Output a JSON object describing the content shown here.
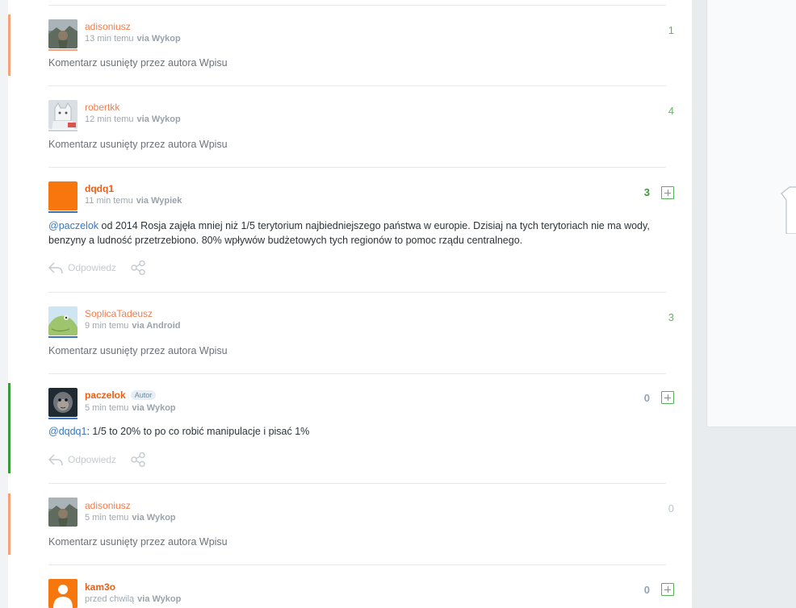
{
  "colors": {
    "username_orange": "#f07c4c",
    "username_strong": "#ee5d14",
    "score_green": "#5cb85c",
    "score_muted": "#8fa5b8",
    "mention_blue": "#3b77b7",
    "marker_orange": "#f4a27a",
    "marker_green": "#3a9a3a"
  },
  "comments": [
    {
      "username": "adisoniusz",
      "time": "13 min temu",
      "via": "via Wykop",
      "score": "1",
      "deleted_text": "Komentarz usunięty przez autora Wpisu",
      "avatar_icon": "landscape-avatar"
    },
    {
      "username": "robertkk",
      "time": "12 min temu",
      "via": "via Wykop",
      "score": "4",
      "deleted_text": "Komentarz usunięty przez autora Wpisu",
      "avatar_icon": "cat-avatar"
    },
    {
      "username": "dqdq1",
      "time": "11 min temu",
      "via": "via Wypiek",
      "score": "3",
      "mention": "@paczelok",
      "text": " od 2014 Rosja zajęła mniej niż 1/5 terytorium najbiedniejszego państwa w europie. Dzisiaj na tych terytoriach nie ma wody, benzyny a ludność przetrzebiono. 80% wpływów budżetowych tych regionów to pomoc rządu centralnego.",
      "reply_label": "Odpowiedz",
      "avatar_icon": "orange-square-avatar"
    },
    {
      "username": "SoplicaTadeusz",
      "time": "9 min temu",
      "via": "via Android",
      "score": "3",
      "deleted_text": "Komentarz usunięty przez autora Wpisu",
      "avatar_icon": "frog-avatar"
    },
    {
      "username": "paczelok",
      "badge": "Autor",
      "time": "5 min temu",
      "via": "via Wykop",
      "score": "0",
      "mention": "@dqdq1",
      "text": ": 1/5 to 20% to po co robić manipulacje i pisać 1%",
      "reply_label": "Odpowiedz",
      "avatar_icon": "monkey-avatar"
    },
    {
      "username": "adisoniusz",
      "time": "5 min temu",
      "via": "via Wykop",
      "score": "0",
      "deleted_text": "Komentarz usunięty przez autora Wpisu",
      "avatar_icon": "landscape-avatar"
    },
    {
      "username": "kam3o",
      "time": "przed chwilą",
      "via": "via Wykop",
      "score": "0",
      "avatar_icon": "default-user-avatar"
    }
  ]
}
